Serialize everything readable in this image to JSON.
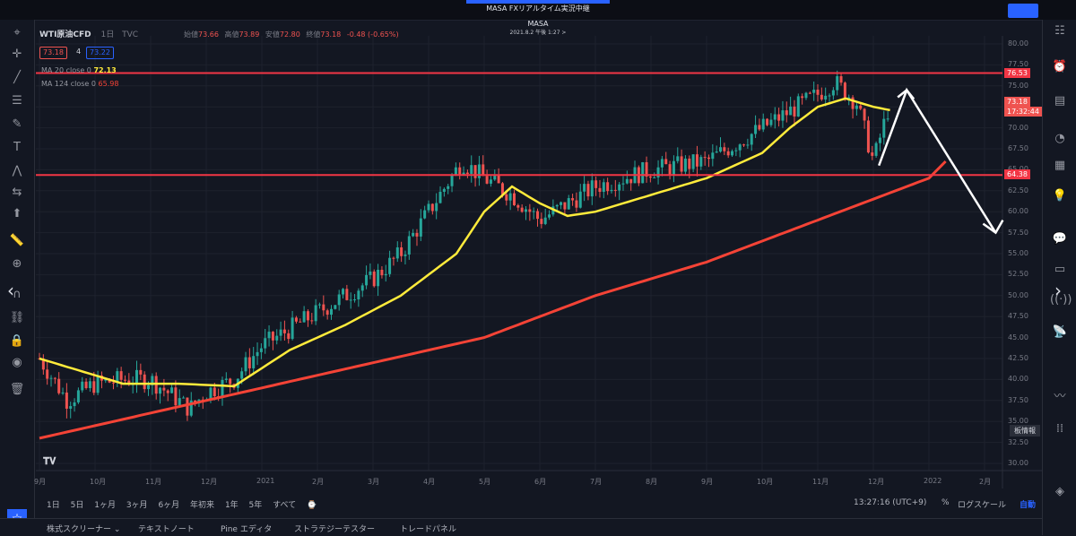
{
  "stream_title": "MASA FXリアルタイム実況中継",
  "overlay": {
    "name": "MASA",
    "date": "2021.8.2 午後 1:27 >"
  },
  "symbol": {
    "name": "WTI原油CFD",
    "interval": "1日",
    "source": "TVC"
  },
  "ohlc": [
    {
      "label": "始値",
      "value": "73.66"
    },
    {
      "label": "高値",
      "value": "73.89"
    },
    {
      "label": "安値",
      "value": "72.80"
    },
    {
      "label": "終値",
      "value": "73.18"
    },
    {
      "label": "",
      "value": "-0.48 (-0.65%)"
    }
  ],
  "bid": "73.18",
  "spread": "4",
  "ask": "73.22",
  "indicators": [
    {
      "label": "MA 20 close 0",
      "value": "72.13",
      "color": "#ffeb3b"
    },
    {
      "label": "MA 124 close 0",
      "value": "65.98",
      "color": "#f44336"
    }
  ],
  "hlines": [
    {
      "value": 76.53,
      "label": "76.53"
    },
    {
      "value": 64.38,
      "label": "64.38"
    }
  ],
  "current_price": {
    "label": "73.18",
    "countdown": "17:32:44"
  },
  "timeframes": [
    "1日",
    "5日",
    "1ヶ月",
    "3ヶ月",
    "6ヶ月",
    "年初来",
    "1年",
    "5年",
    "すべて"
  ],
  "clock": "13:27:16 (UTC+9)",
  "percent_label": "%",
  "log_label": "ログスケール",
  "auto_label": "自動",
  "tooltip": "板情報",
  "bottom_tabs": [
    "株式スクリーナー ⌄",
    "テキストノート",
    "Pine エディタ",
    "ストラテジーテスター",
    "トレードパネル"
  ],
  "chart_data": {
    "type": "candlestick",
    "y_ticks": [
      "80.00",
      "77.50",
      "75.00",
      "72.50",
      "70.00",
      "67.50",
      "65.00",
      "62.50",
      "60.00",
      "57.50",
      "55.00",
      "52.50",
      "50.00",
      "47.50",
      "45.00",
      "42.50",
      "40.00",
      "37.50",
      "35.00",
      "32.50",
      "30.00"
    ],
    "ylim": [
      30,
      80
    ],
    "x_ticks": [
      "9月",
      "10月",
      "11月",
      "12月",
      "2021",
      "2月",
      "3月",
      "4月",
      "5月",
      "6月",
      "7月",
      "8月",
      "9月",
      "10月",
      "11月",
      "12月",
      "2022",
      "2月"
    ],
    "ma20_approx": [
      [
        0,
        42.5
      ],
      [
        1.5,
        39.5
      ],
      [
        2.5,
        39.5
      ],
      [
        3.5,
        39.2
      ],
      [
        4.5,
        43.5
      ],
      [
        5.5,
        46.5
      ],
      [
        6.5,
        50
      ],
      [
        7.5,
        55
      ],
      [
        8,
        60
      ],
      [
        8.5,
        63
      ],
      [
        9,
        61
      ],
      [
        9.5,
        59.5
      ],
      [
        10,
        60
      ],
      [
        11,
        62
      ],
      [
        12,
        64
      ],
      [
        13,
        67
      ],
      [
        13.5,
        70
      ],
      [
        14,
        72.5
      ],
      [
        14.5,
        73.5
      ],
      [
        15,
        72.5
      ],
      [
        15.3,
        72.1
      ]
    ],
    "ma124_approx": [
      [
        0,
        33
      ],
      [
        2,
        36
      ],
      [
        4,
        39
      ],
      [
        6,
        42
      ],
      [
        8,
        45
      ],
      [
        10,
        50
      ],
      [
        12,
        54
      ],
      [
        14,
        59
      ],
      [
        16,
        64
      ],
      [
        16.3,
        66
      ]
    ],
    "projection": [
      [
        15.1,
        65.5
      ],
      [
        15.6,
        74.5
      ],
      [
        17.2,
        57.5
      ]
    ]
  },
  "colors": {
    "up": "#26a69a",
    "down": "#ef5350",
    "hline": "#f23645",
    "ma20": "#ffeb3b",
    "ma124": "#f44336",
    "accent": "#2962ff"
  }
}
